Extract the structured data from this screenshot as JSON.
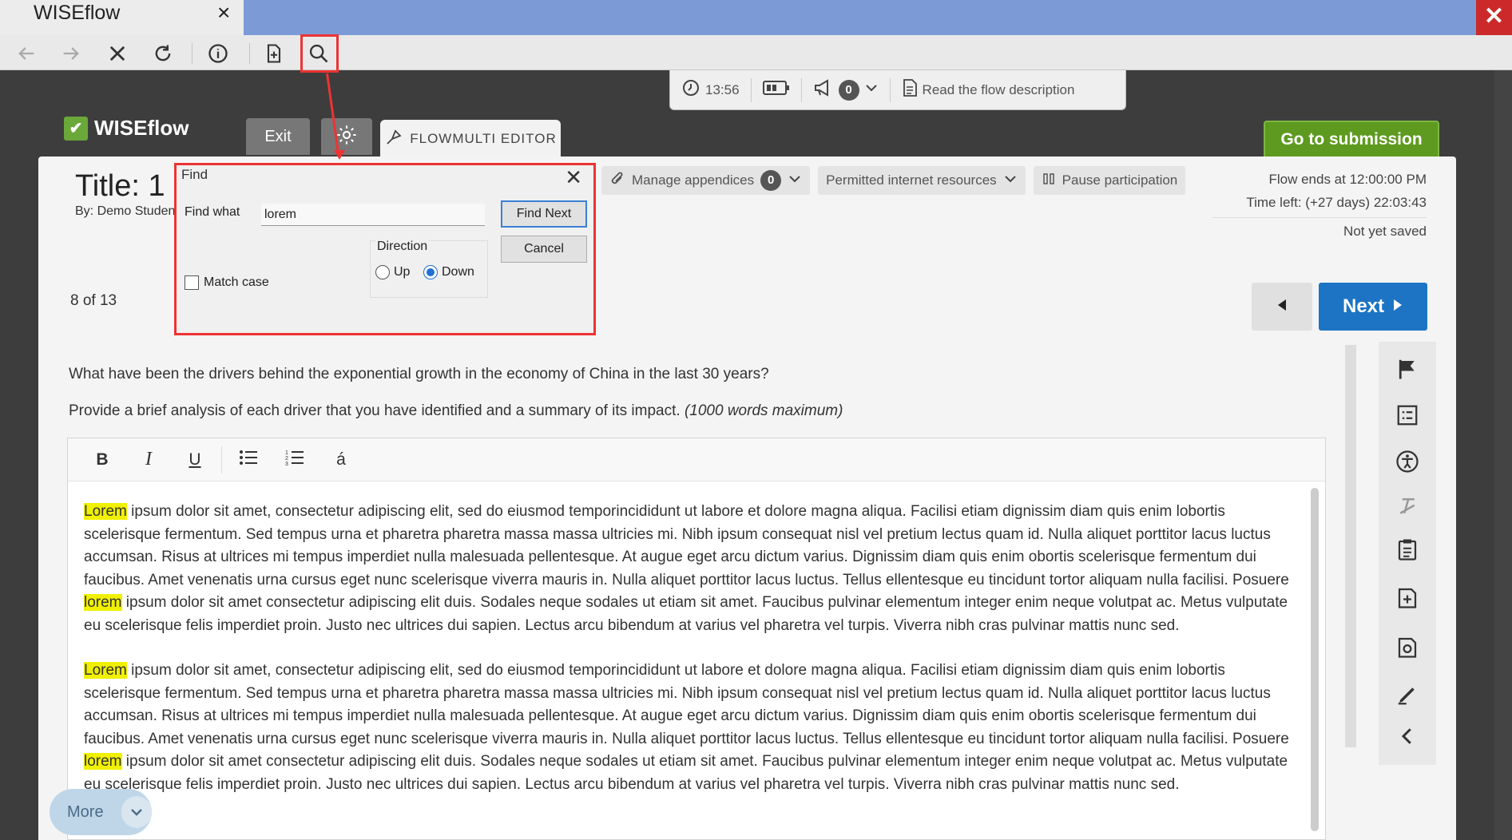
{
  "browser": {
    "tab_title": "WISEflow",
    "tab_close": "×",
    "window_close": "✕"
  },
  "statusbar": {
    "timer": "13:56",
    "notifications_count": "0",
    "read_description": "Read the flow description"
  },
  "header": {
    "logo": "WISEflow",
    "exit_label": "Exit",
    "editor_tab_label": "FLOWMULTI EDITOR",
    "submission_label": "Go to submission"
  },
  "main": {
    "title": "Title: 1",
    "byline": "By: Demo Studen",
    "page_indicator": "8 of 13",
    "manage_appendices": "Manage appendices",
    "appendices_count": "0",
    "permitted_resources": "Permitted internet resources",
    "pause_participation": "Pause participation",
    "flow_ends": "Flow ends at 12:00:00 PM",
    "time_left": "Time left: (+27 days) 22:03:43",
    "save_status": "Not yet saved",
    "next_label": "Next",
    "question_line1": "What have been the drivers behind the exponential growth in the economy of China in the last 30 years?",
    "question_line2": "Provide a brief analysis of each driver that you have identified and a summary of its impact.",
    "question_note": "(1000 words maximum)"
  },
  "editor": {
    "toolbar": {
      "bold": "B",
      "italic": "I",
      "underline": "U",
      "special_char": "á"
    },
    "paragraphs": [
      {
        "hl1": "Lorem",
        "part1": " ipsum dolor sit amet, consectetur adipiscing elit, sed do eiusmod temporincididunt ut labore et dolore magna aliqua. Facilisi etiam dignissim diam quis enim lobortis scelerisque fermentum. Sed tempus urna et pharetra pharetra massa massa ultricies mi. Nibh ipsum consequat nisl vel pretium lectus quam id. Nulla aliquet porttitor lacus luctus accumsan. Risus at ultrices mi tempus imperdiet nulla malesuada pellentesque. At augue eget arcu dictum varius. Dignissim diam quis enim obortis scelerisque fermentum dui faucibus. Amet venenatis urna cursus eget nunc scelerisque viverra mauris in. Nulla aliquet porttitor lacus luctus. Tellus ellentesque eu tincidunt tortor aliquam nulla facilisi. Posuere ",
        "hl2": "lorem",
        "part2": " ipsum dolor sit amet consectetur adipiscing elit duis. Sodales neque sodales ut etiam sit amet. Faucibus pulvinar elementum integer enim neque volutpat ac. Metus vulputate eu scelerisque felis imperdiet proin. Justo nec ultrices dui sapien. Lectus arcu bibendum at varius vel pharetra vel turpis. Viverra nibh cras pulvinar mattis nunc sed."
      },
      {
        "hl1": "Lorem",
        "part1": " ipsum dolor sit amet, consectetur adipiscing elit, sed do eiusmod temporincididunt ut labore et dolore magna aliqua. Facilisi etiam dignissim diam quis enim lobortis scelerisque fermentum. Sed tempus urna et pharetra pharetra massa massa ultricies mi. Nibh ipsum consequat nisl vel pretium lectus quam id. Nulla aliquet porttitor lacus luctus accumsan. Risus at ultrices mi tempus imperdiet nulla malesuada pellentesque. At augue eget arcu dictum varius. Dignissim diam quis enim obortis scelerisque fermentum dui faucibus. Amet venenatis urna cursus eget nunc scelerisque viverra mauris in. Nulla aliquet porttitor lacus luctus. Tellus ellentesque eu tincidunt tortor aliquam nulla facilisi. Posuere ",
        "hl2": "lorem",
        "part2": " ipsum dolor sit amet consectetur adipiscing elit duis. Sodales neque sodales ut etiam sit amet. Faucibus pulvinar elementum integer enim neque volutpat ac. Metus vulputate eu scelerisque felis imperdiet proin. Justo nec ultrices dui sapien. Lectus arcu bibendum at varius vel pharetra vel turpis. Viverra nibh cras pulvinar mattis nunc sed."
      }
    ],
    "more_label": "More"
  },
  "find_dialog": {
    "title": "Find",
    "close": "✕",
    "find_what_label": "Find what",
    "find_what_value": "lorem",
    "find_next_label": "Find Next",
    "cancel_label": "Cancel",
    "direction_label": "Direction",
    "up_label": "Up",
    "down_label": "Down",
    "match_case_label": "Match case"
  },
  "colors": {
    "next_blue": "#1d74c4",
    "submission_green": "#5e9a1f",
    "highlight_yellow": "#f0f000",
    "annotation_red": "#e33333"
  }
}
